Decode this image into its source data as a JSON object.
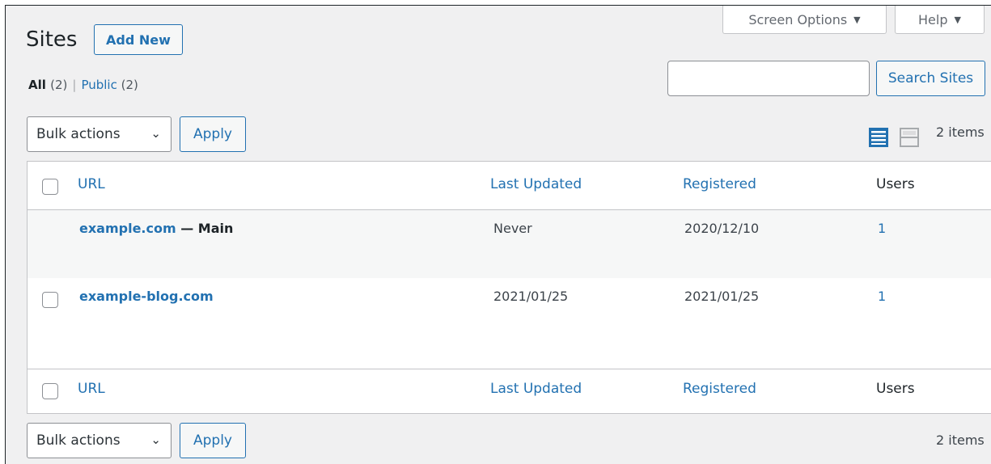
{
  "screen_meta": {
    "screen_options_label": "Screen Options",
    "help_label": "Help",
    "arrow": "▼"
  },
  "header": {
    "title": "Sites",
    "add_new_label": "Add New"
  },
  "filters": {
    "all_label": "All",
    "all_count": "(2)",
    "separator": "|",
    "public_label": "Public",
    "public_count": "(2)"
  },
  "search": {
    "value": "",
    "button_label": "Search Sites"
  },
  "tablenav_top": {
    "bulk_actions_value": "Bulk actions",
    "bulk_actions_chevron": "⌄",
    "apply_label": "Apply",
    "view_modes": [
      "list-view-icon",
      "excerpt-view-icon"
    ],
    "items_count": "2 items"
  },
  "table": {
    "columns": [
      "URL",
      "Last Updated",
      "Registered",
      "Users"
    ],
    "rows": [
      {
        "site": "example.com",
        "suffix": " — Main",
        "last_updated": "Never",
        "registered": "2020/12/10",
        "users": "1",
        "checkbox": false
      },
      {
        "site": "example-blog.com",
        "suffix": "",
        "last_updated": "2021/01/25",
        "registered": "2021/01/25",
        "users": "1",
        "checkbox": true
      }
    ]
  },
  "tablenav_bottom": {
    "bulk_actions_value": "Bulk actions",
    "bulk_actions_chevron": "⌄",
    "apply_label": "Apply",
    "items_count": "2 items"
  },
  "colors": {
    "link": "#2271b1",
    "background": "#f0f0f1",
    "text": "#1d2327",
    "border": "#c3c4c7"
  }
}
